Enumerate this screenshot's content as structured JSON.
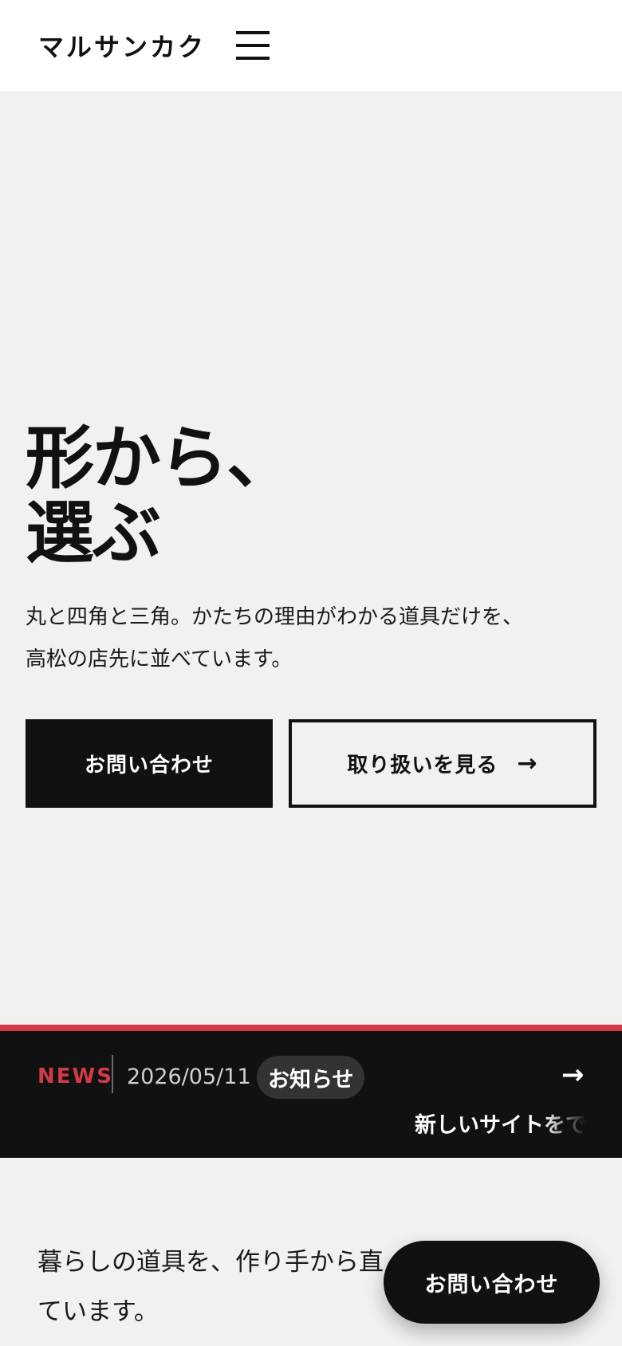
{
  "header": {
    "logo": "マルサンカク",
    "menu_icon": "hamburger-menu-icon"
  },
  "hero": {
    "title_lines": [
      "形から、",
      "選ぶ"
    ],
    "description_lines": [
      "丸と四角と三角。かたちの理由がわかる道具だけを、",
      "高松の店先に並べています。"
    ],
    "primary_button": "お問い合わせ",
    "secondary_button": "取り扱いを見る",
    "secondary_icon": "arrow-right-icon"
  },
  "news": {
    "label": "NEWS",
    "date": "2026/05/11",
    "category": "お知らせ",
    "ticker_text": "新しいサイトをで",
    "arrow_icon": "arrow-right-icon"
  },
  "intro": {
    "lines": [
      "暮らしの道具を、作り手から直",
      "ています。"
    ]
  },
  "floating_cta": {
    "label": "お問い合わせ"
  },
  "colors": {
    "background": "#f3f1ef",
    "header_bg": "#ffffff",
    "primary": "#111111",
    "accent_red": "#d23a45",
    "category_pill": "#333333"
  }
}
